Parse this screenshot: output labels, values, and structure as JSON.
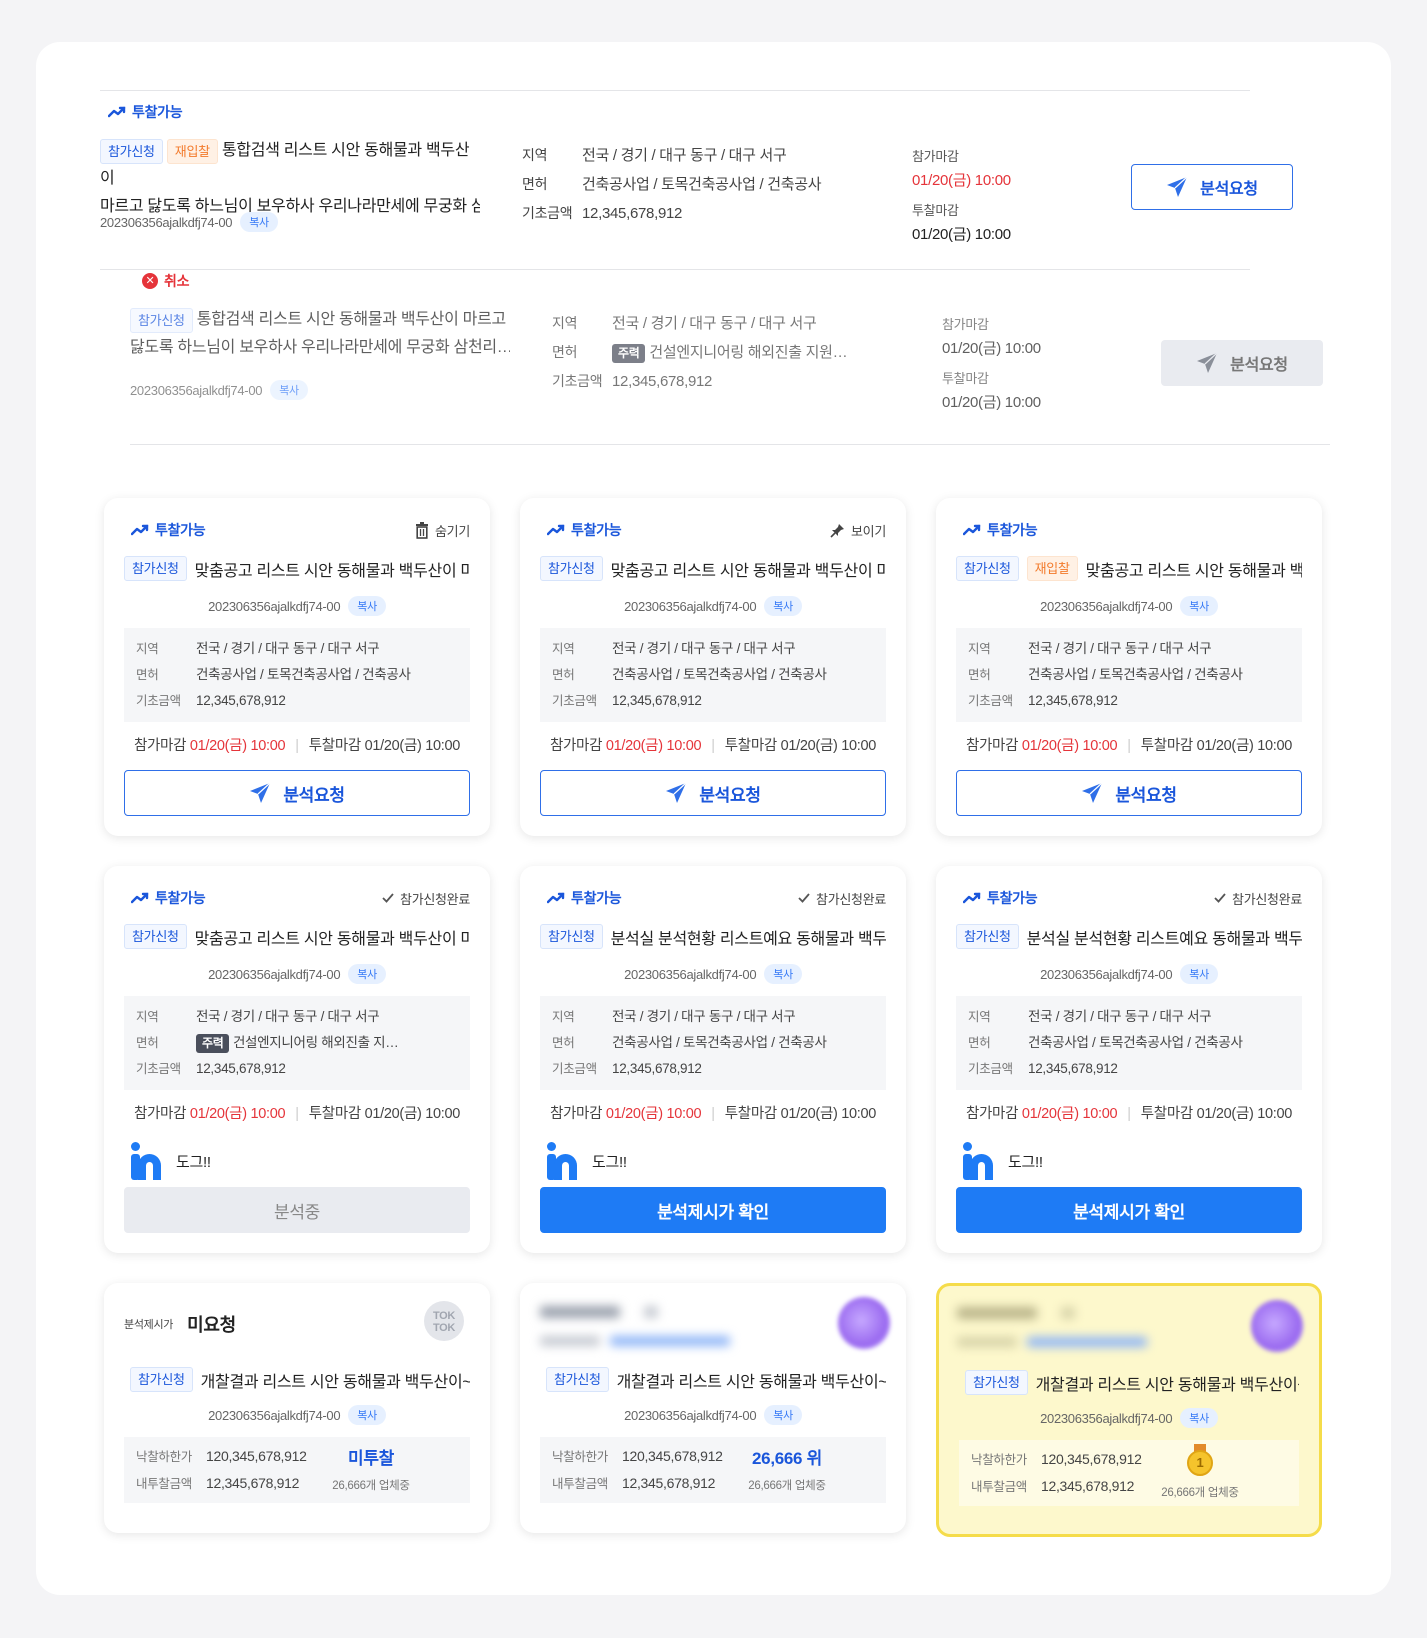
{
  "rows": [
    {
      "status": "투찰가능",
      "tags": [
        "참가신청",
        "재입찰"
      ],
      "title1": "통합검색 리스트 시안 동해물과 백두산이",
      "title2": "마르고 닳도록 하느님이 보우하사 우리나라만세에 무궁화 삼…",
      "code": "202306356ajalkdfj74-00",
      "copy": "복사",
      "region_label": "지역",
      "region": "전국 / 경기 / 대구 동구 / 대구 서구",
      "license_label": "면허",
      "license": "건축공사업 / 토목건축공사업 / 건축공사",
      "amount_label": "기초금액",
      "amount": "12,345,678,912",
      "join_label": "참가마감",
      "join_value": "01/20(금) 10:00",
      "bid_label": "투찰마감",
      "bid_value": "01/20(금) 10:00",
      "button": "분석요청"
    },
    {
      "status": "취소",
      "tags": [
        "참가신청"
      ],
      "title1": "통합검색 리스트 시안 동해물과 백두산이 마르고",
      "title2": "닳도록 하느님이 보우하사 우리나라만세에 무궁화 삼천리…",
      "code": "202306356ajalkdfj74-00",
      "copy": "복사",
      "region_label": "지역",
      "region": "전국 / 경기 / 대구 동구 / 대구 서구",
      "license_label": "면허",
      "license_tag": "주력",
      "license": "건설엔지니어링 해외진출 지원…",
      "amount_label": "기초금액",
      "amount": "12,345,678,912",
      "join_label": "참가마감",
      "join_value": "01/20(금) 10:00",
      "bid_label": "투찰마감",
      "bid_value": "01/20(금) 10:00",
      "button": "분석요청"
    }
  ],
  "cards": [
    {
      "status": "투찰가능",
      "right": "숨기기",
      "right_icon": "trash-icon",
      "tags": [
        "참가신청"
      ],
      "title": "맞춤공고 리스트 시안 동해물과 백두산이 마르고",
      "code": "202306356ajalkdfj74-00",
      "copy": "복사",
      "region_label": "지역",
      "region": "전국 / 경기 / 대구 동구 / 대구 서구",
      "license_label": "면허",
      "license": "건축공사업 / 토목건축공사업 / 건축공사",
      "amount_label": "기초금액",
      "amount": "12,345,678,912",
      "join_label": "참가마감",
      "join_value": "01/20(금) 10:00",
      "bid_label": "투찰마감",
      "bid_value": "01/20(금) 10:00",
      "button": "분석요청"
    },
    {
      "status": "투찰가능",
      "right": "보이기",
      "right_icon": "pin-icon",
      "tags": [
        "참가신청"
      ],
      "title": "맞춤공고 리스트 시안 동해물과 백두산이 마르고",
      "code": "202306356ajalkdfj74-00",
      "copy": "복사",
      "region_label": "지역",
      "region": "전국 / 경기 / 대구 동구 / 대구 서구",
      "license_label": "면허",
      "license": "건축공사업 / 토목건축공사업 / 건축공사",
      "amount_label": "기초금액",
      "amount": "12,345,678,912",
      "join_label": "참가마감",
      "join_value": "01/20(금) 10:00",
      "bid_label": "투찰마감",
      "bid_value": "01/20(금) 10:00",
      "button": "분석요청"
    },
    {
      "status": "투찰가능",
      "right": "",
      "tags": [
        "참가신청",
        "재입찰"
      ],
      "title": "맞춤공고 리스트 시안 동해물과 백두산이",
      "code": "202306356ajalkdfj74-00",
      "copy": "복사",
      "region_label": "지역",
      "region": "전국 / 경기 / 대구 동구 / 대구 서구",
      "license_label": "면허",
      "license": "건축공사업 / 토목건축공사업 / 건축공사",
      "amount_label": "기초금액",
      "amount": "12,345,678,912",
      "join_label": "참가마감",
      "join_value": "01/20(금) 10:00",
      "bid_label": "투찰마감",
      "bid_value": "01/20(금) 10:00",
      "button": "분석요청"
    },
    {
      "status": "투찰가능",
      "right": "참가신청완료",
      "tags": [
        "참가신청"
      ],
      "title": "맞춤공고 리스트 시안 동해물과 백두산이 마르고",
      "code": "202306356ajalkdfj74-00",
      "copy": "복사",
      "region_label": "지역",
      "region": "전국 / 경기 / 대구 동구 / 대구 서구",
      "license_label": "면허",
      "license_tag": "주력",
      "license": "건설엔지니어링 해외진출 지…",
      "amount_label": "기초금액",
      "amount": "12,345,678,912",
      "join_label": "참가마감",
      "join_value": "01/20(금) 10:00",
      "bid_label": "투찰마감",
      "bid_value": "01/20(금) 10:00",
      "comment": "도그!!",
      "button": "분석중"
    },
    {
      "status": "투찰가능",
      "right": "참가신청완료",
      "tags": [
        "참가신청"
      ],
      "title": "분석실 분석현황 리스트예요 동해물과 백두산이",
      "code": "202306356ajalkdfj74-00",
      "copy": "복사",
      "region_label": "지역",
      "region": "전국 / 경기 / 대구 동구 / 대구 서구",
      "license_label": "면허",
      "license": "건축공사업 / 토목건축공사업 / 건축공사",
      "amount_label": "기초금액",
      "amount": "12,345,678,912",
      "join_label": "참가마감",
      "join_value": "01/20(금) 10:00",
      "bid_label": "투찰마감",
      "bid_value": "01/20(금) 10:00",
      "comment": "도그!!",
      "button": "분석제시가 확인"
    },
    {
      "status": "투찰가능",
      "right": "참가신청완료",
      "tags": [
        "참가신청"
      ],
      "title": "분석실 분석현황 리스트예요 동해물과 백두산이",
      "code": "202306356ajalkdfj74-00",
      "copy": "복사",
      "region_label": "지역",
      "region": "전국 / 경기 / 대구 동구 / 대구 서구",
      "license_label": "면허",
      "license": "건축공사업 / 토목건축공사업 / 건축공사",
      "amount_label": "기초금액",
      "amount": "12,345,678,912",
      "join_label": "참가마감",
      "join_value": "01/20(금) 10:00",
      "bid_label": "투찰마감",
      "bid_value": "01/20(금) 10:00",
      "comment": "도그!!",
      "button": "분석제시가 확인"
    }
  ],
  "results": [
    {
      "head_label": "분석제시가",
      "head_value": "미요청",
      "badge": "TOK TOK",
      "tag": "참가신청",
      "title": "개찰결과 리스트 시안 동해물과 백두산이~~",
      "code": "202306356ajalkdfj74-00",
      "copy": "복사",
      "low_label": "낙찰하한가",
      "low_value": "120,345,678,912",
      "my_label": "내투찰금액",
      "my_value": "12,345,678,912",
      "result": "미투찰",
      "companies": "26,666개 업체중"
    },
    {
      "tag": "참가신청",
      "title": "개찰결과 리스트 시안 동해물과 백두산이~~",
      "code": "202306356ajalkdfj74-00",
      "copy": "복사",
      "low_label": "낙찰하한가",
      "low_value": "120,345,678,912",
      "my_label": "내투찰금액",
      "my_value": "12,345,678,912",
      "result": "26,666 위",
      "companies": "26,666개 업체중"
    },
    {
      "tag": "참가신청",
      "title": "개찰결과 리스트 시안 동해물과 백두산이~~",
      "code": "202306356ajalkdfj74-00",
      "copy": "복사",
      "low_label": "낙찰하한가",
      "low_value": "120,345,678,912",
      "my_label": "내투찰금액",
      "my_value": "12,345,678,912",
      "medal": "1",
      "companies": "26,666개 업체중"
    }
  ],
  "colors": {
    "brand": "#1e7bf5",
    "link": "#1a56db",
    "danger": "#e5343a",
    "gold_border": "#f5dc4a"
  }
}
